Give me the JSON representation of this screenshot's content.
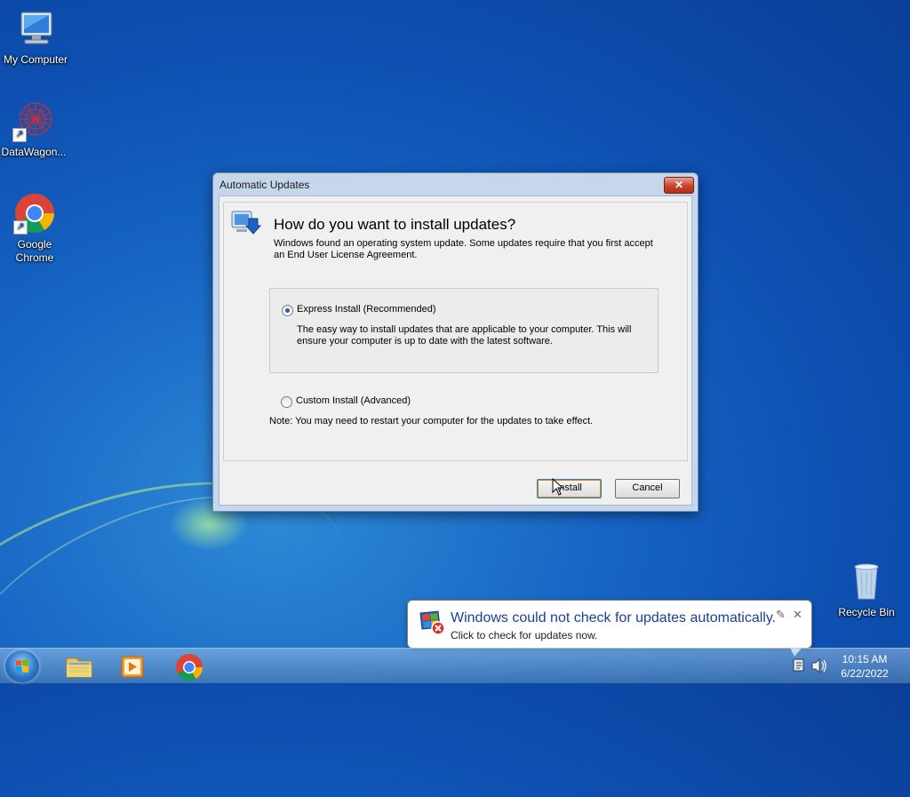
{
  "desktop": {
    "icons": [
      {
        "label": "My Computer"
      },
      {
        "label": "DataWagon..."
      },
      {
        "label": "Google Chrome"
      },
      {
        "label": "Recycle Bin"
      }
    ]
  },
  "dialog": {
    "title": "Automatic Updates",
    "close_glyph": "✕",
    "heading": "How do you want to install updates?",
    "intro": "Windows found an operating system update. Some updates require that you first accept an End User License Agreement.",
    "options": [
      {
        "label": "Express Install (Recommended)",
        "selected": true,
        "description": "The easy way to install updates that are applicable to your computer. This will ensure your computer is up to date with the latest software."
      },
      {
        "label": "Custom Install (Advanced)",
        "selected": false
      }
    ],
    "note": "Note: You may need to restart your computer for the updates to take effect.",
    "buttons": {
      "install": "Install",
      "cancel": "Cancel"
    }
  },
  "balloon": {
    "title": "Windows could not check for updates automatically.",
    "text": "Click to check for updates now.",
    "options_glyph": "✎",
    "close_glyph": "✕"
  },
  "taskbar": {
    "pinned": [
      {
        "icon": "windows-explorer-icon"
      },
      {
        "icon": "media-player-icon"
      },
      {
        "icon": "chrome-icon"
      }
    ],
    "clock": {
      "time": "10:15 AM",
      "date": "6/22/2022"
    }
  },
  "colors": {
    "desktop": "#0d4fb0",
    "link_blue": "#1e3f9a",
    "close_red": "#c7422d"
  }
}
